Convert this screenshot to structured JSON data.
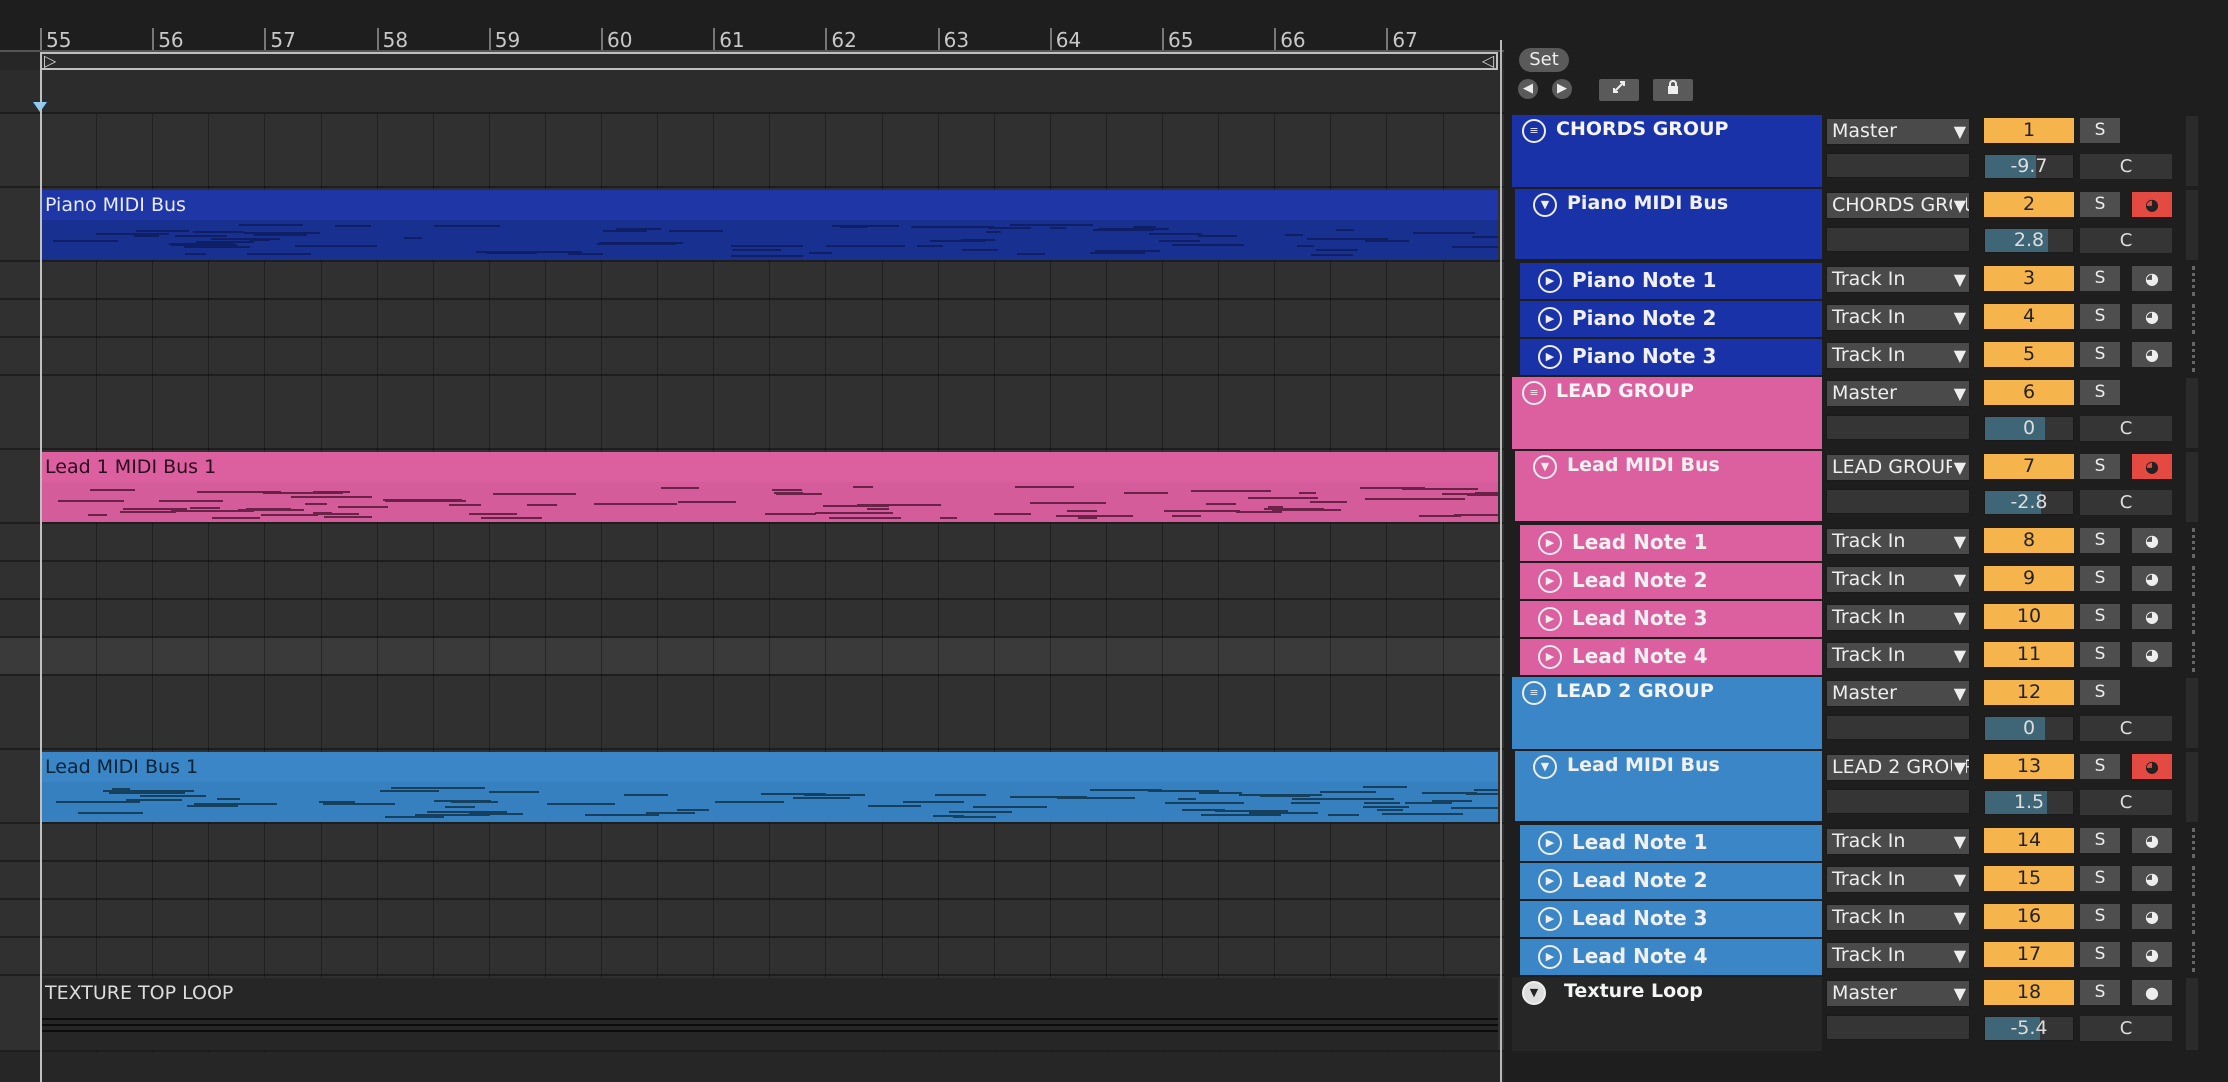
{
  "ruler": {
    "bars": [
      "55",
      "56",
      "57",
      "58",
      "59",
      "60",
      "61",
      "62",
      "63",
      "64",
      "65",
      "66",
      "67"
    ]
  },
  "set_panel": {
    "set_label": "Set",
    "back_glyph": "◀",
    "forward_glyph": "▶",
    "expand_icon": "expand-icon",
    "lock_icon": "lock-icon"
  },
  "colors": {
    "chords": "#1a32a8",
    "piano_clip": "#1e36a6",
    "lead": "#dc5fa0",
    "lead2": "#3a86c6",
    "texture": "#262626",
    "track_number": "#f5b44c",
    "arm_red": "#e44a42"
  },
  "labels": {
    "solo": "S",
    "crossfade": "C"
  },
  "clips": [
    {
      "name": "Piano MIDI Bus"
    },
    {
      "name": "Lead 1 MIDI Bus 1"
    },
    {
      "name": "Lead MIDI Bus 1"
    },
    {
      "name": "TEXTURE TOP LOOP"
    }
  ],
  "tracks": [
    {
      "name": "CHORDS GROUP",
      "type": "group",
      "input": "Master",
      "number": "1",
      "volume": "-9.7",
      "volume_level": 0.58
    },
    {
      "name": "Piano MIDI Bus",
      "type": "bus",
      "input": "CHORDS GROUP",
      "number": "2",
      "volume": "2.8",
      "volume_level": 0.72,
      "armed": true
    },
    {
      "name": "Piano Note 1",
      "type": "track",
      "input": "Track In",
      "number": "3"
    },
    {
      "name": "Piano Note 2",
      "type": "track",
      "input": "Track In",
      "number": "4"
    },
    {
      "name": "Piano Note 3",
      "type": "track",
      "input": "Track In",
      "number": "5"
    },
    {
      "name": "LEAD GROUP",
      "type": "group",
      "input": "Master",
      "number": "6",
      "volume": "0",
      "volume_level": 0.68
    },
    {
      "name": "Lead MIDI Bus",
      "type": "bus",
      "input": "LEAD GROUP",
      "number": "7",
      "volume": "-2.8",
      "volume_level": 0.64,
      "armed": true
    },
    {
      "name": "Lead Note 1",
      "type": "track",
      "input": "Track In",
      "number": "8"
    },
    {
      "name": "Lead Note 2",
      "type": "track",
      "input": "Track In",
      "number": "9"
    },
    {
      "name": "Lead Note 3",
      "type": "track",
      "input": "Track In",
      "number": "10"
    },
    {
      "name": "Lead Note 4",
      "type": "track",
      "input": "Track In",
      "number": "11"
    },
    {
      "name": "LEAD 2 GROUP",
      "type": "group",
      "input": "Master",
      "number": "12",
      "volume": "0",
      "volume_level": 0.68
    },
    {
      "name": "Lead MIDI Bus",
      "type": "bus",
      "input": "LEAD 2 GROUP",
      "number": "13",
      "volume": "1.5",
      "volume_level": 0.7,
      "armed": true
    },
    {
      "name": "Lead Note 1",
      "type": "track",
      "input": "Track In",
      "number": "14"
    },
    {
      "name": "Lead Note 2",
      "type": "track",
      "input": "Track In",
      "number": "15"
    },
    {
      "name": "Lead Note 3",
      "type": "track",
      "input": "Track In",
      "number": "16"
    },
    {
      "name": "Lead Note 4",
      "type": "track",
      "input": "Track In",
      "number": "17"
    },
    {
      "name": "Texture Loop",
      "type": "audio",
      "input": "Master",
      "number": "18",
      "volume": "-5.4",
      "volume_level": 0.62
    }
  ]
}
